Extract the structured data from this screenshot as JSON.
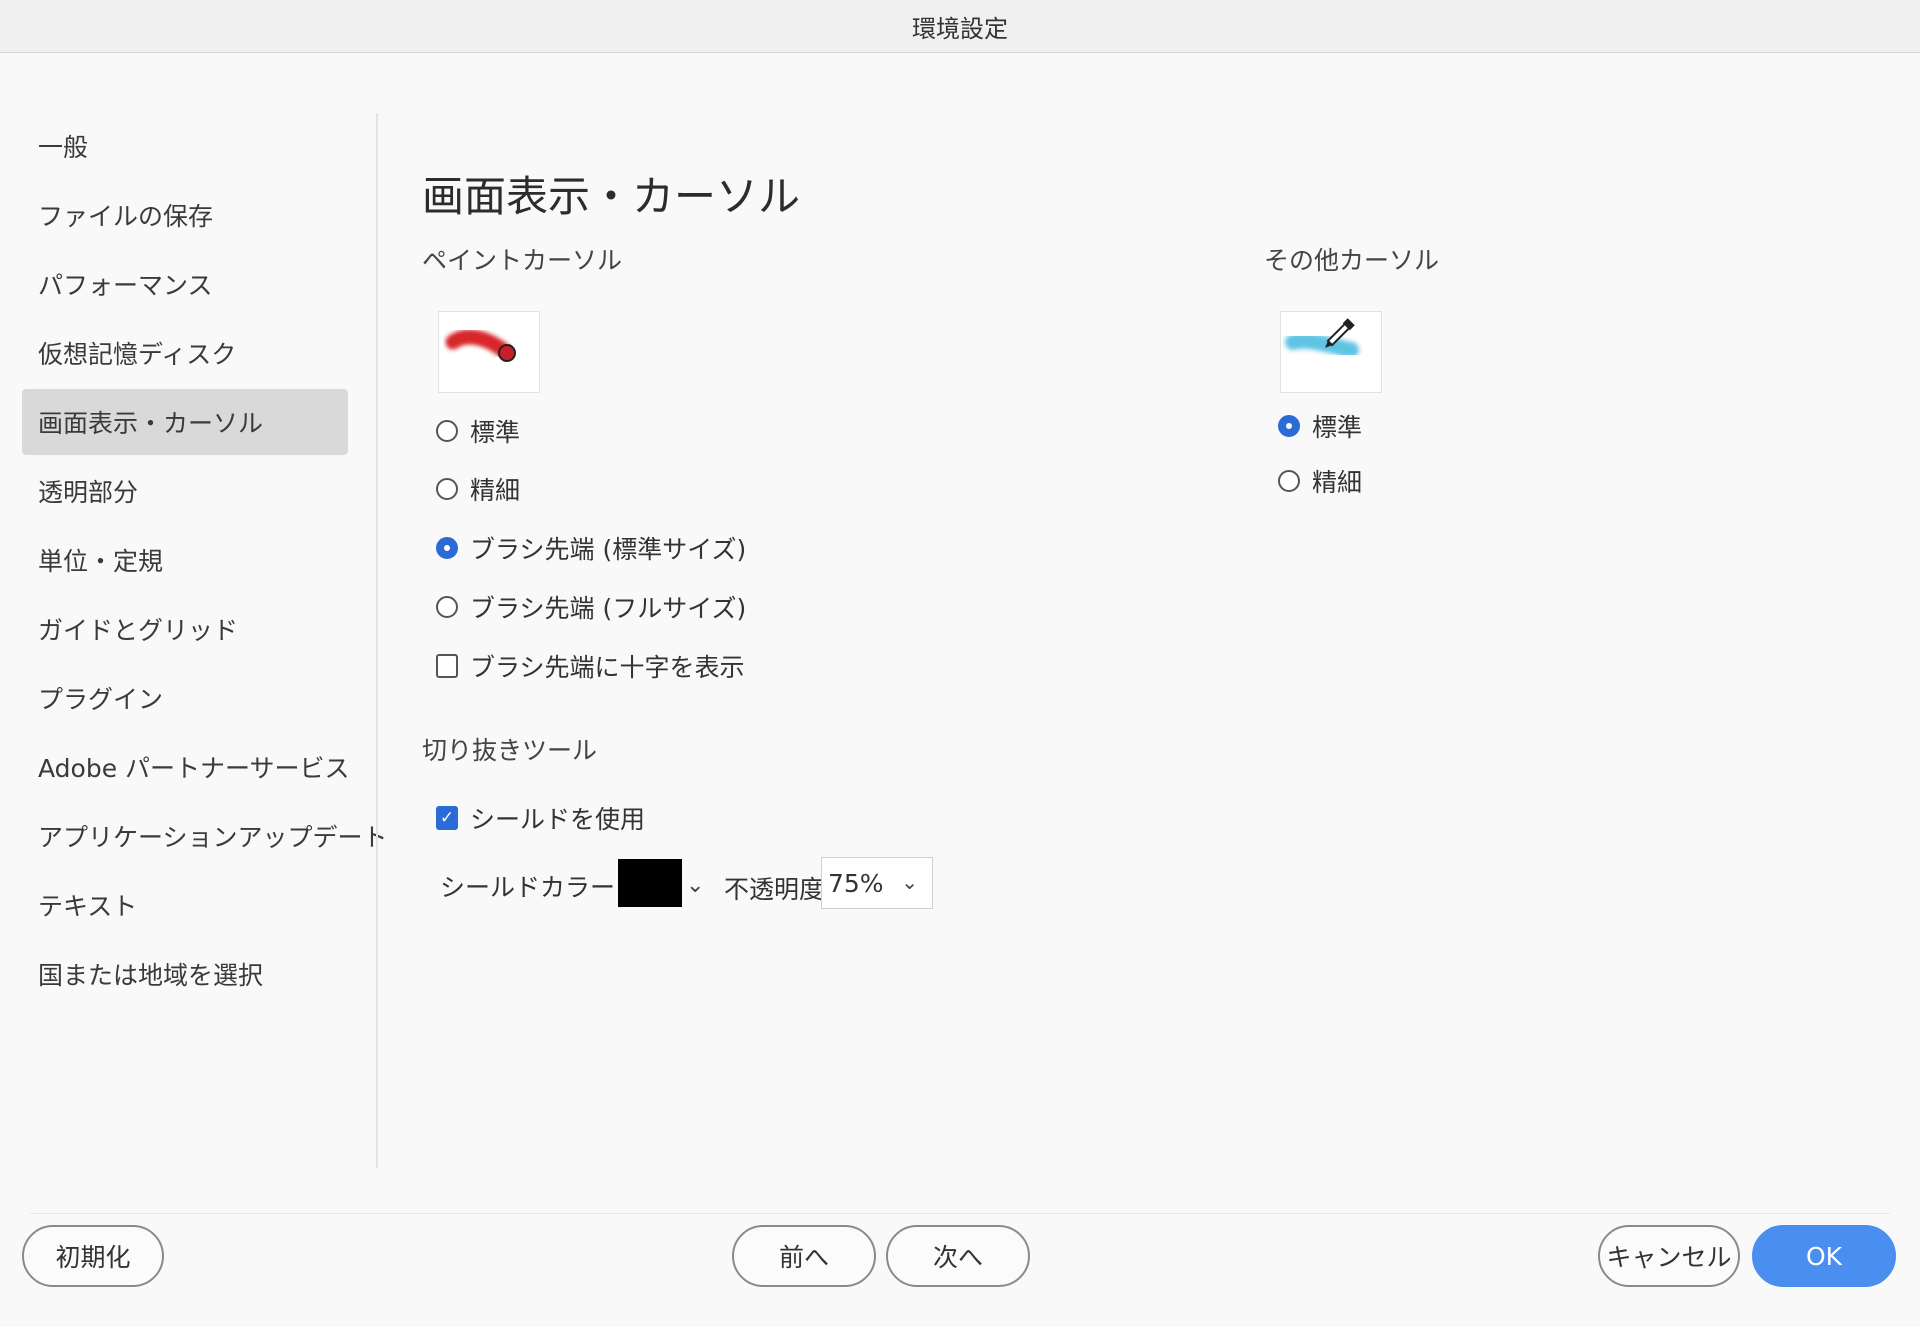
{
  "window": {
    "title": "環境設定"
  },
  "sidebar": {
    "items": [
      {
        "label": "一般"
      },
      {
        "label": "ファイルの保存"
      },
      {
        "label": "パフォーマンス"
      },
      {
        "label": "仮想記憶ディスク"
      },
      {
        "label": "画面表示・カーソル",
        "selected": true
      },
      {
        "label": "透明部分"
      },
      {
        "label": "単位・定規"
      },
      {
        "label": "ガイドとグリッド"
      },
      {
        "label": "プラグイン"
      },
      {
        "label": "Adobe パートナーサービス"
      },
      {
        "label": "アプリケーションアップデート"
      },
      {
        "label": "テキスト"
      },
      {
        "label": "国または地域を選択"
      }
    ]
  },
  "main": {
    "title": "画面表示・カーソル",
    "paint_cursors": {
      "label": "ペイントカーソル",
      "preview_icon": "brush-circle-cursor-icon",
      "options": [
        {
          "label": "標準",
          "checked": false
        },
        {
          "label": "精細",
          "checked": false
        },
        {
          "label": "ブラシ先端 (標準サイズ)",
          "checked": true
        },
        {
          "label": "ブラシ先端 (フルサイズ)",
          "checked": false
        }
      ],
      "crosshair": {
        "label": "ブラシ先端に十字を表示",
        "checked": false
      }
    },
    "other_cursors": {
      "label": "その他カーソル",
      "preview_icon": "eyedropper-cursor-icon",
      "options": [
        {
          "label": "標準",
          "checked": true
        },
        {
          "label": "精細",
          "checked": false
        }
      ]
    },
    "crop_tool": {
      "label": "切り抜きツール",
      "use_shield": {
        "label": "シールドを使用",
        "checked": true
      },
      "shield_color_label": "シールドカラー :",
      "shield_color": "#000000",
      "opacity_label": "不透明度:",
      "opacity_value": "75%"
    }
  },
  "footer": {
    "reset": "初期化",
    "prev": "前へ",
    "next": "次へ",
    "cancel": "キャンセル",
    "ok": "OK"
  },
  "colors": {
    "accent": "#2a6bd6",
    "primary_button": "#4a8ef0",
    "selected_bg": "#d9d9d9"
  }
}
